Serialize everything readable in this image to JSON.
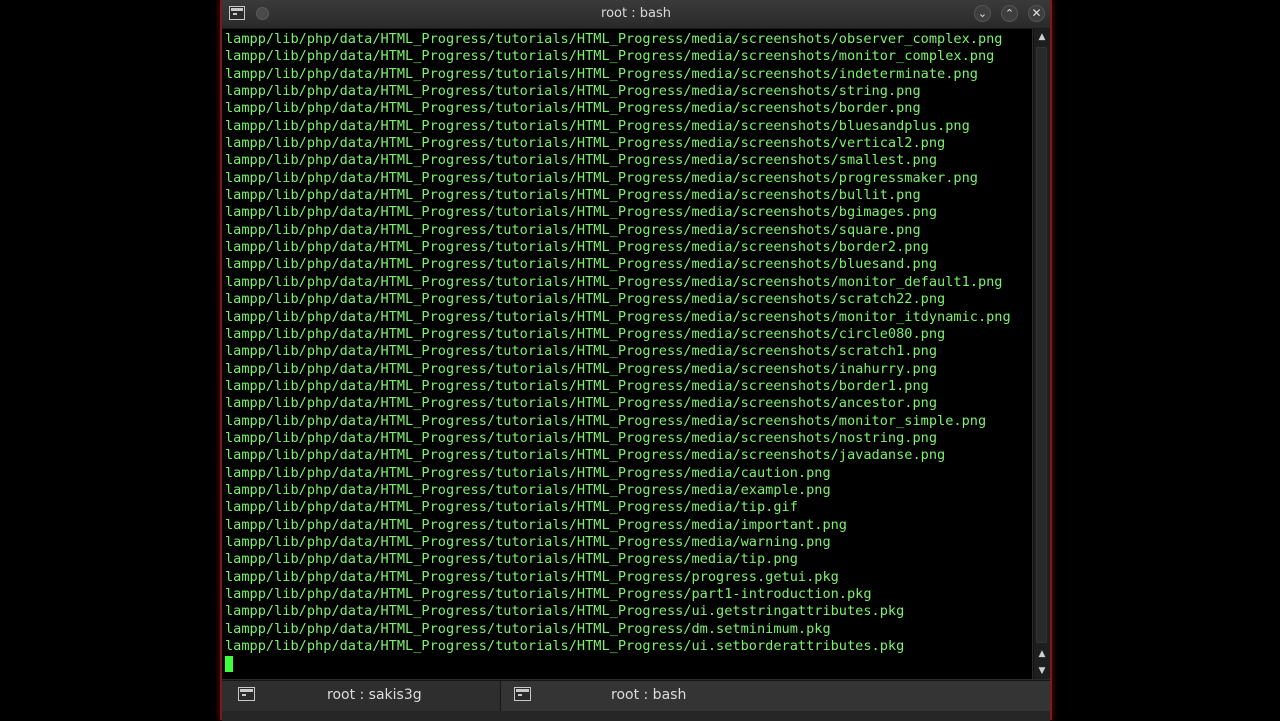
{
  "window": {
    "title": "root : bash"
  },
  "terminal": {
    "lines": [
      "lampp/lib/php/data/HTML_Progress/tutorials/HTML_Progress/media/screenshots/observer_complex.png",
      "lampp/lib/php/data/HTML_Progress/tutorials/HTML_Progress/media/screenshots/monitor_complex.png",
      "lampp/lib/php/data/HTML_Progress/tutorials/HTML_Progress/media/screenshots/indeterminate.png",
      "lampp/lib/php/data/HTML_Progress/tutorials/HTML_Progress/media/screenshots/string.png",
      "lampp/lib/php/data/HTML_Progress/tutorials/HTML_Progress/media/screenshots/border.png",
      "lampp/lib/php/data/HTML_Progress/tutorials/HTML_Progress/media/screenshots/bluesandplus.png",
      "lampp/lib/php/data/HTML_Progress/tutorials/HTML_Progress/media/screenshots/vertical2.png",
      "lampp/lib/php/data/HTML_Progress/tutorials/HTML_Progress/media/screenshots/smallest.png",
      "lampp/lib/php/data/HTML_Progress/tutorials/HTML_Progress/media/screenshots/progressmaker.png",
      "lampp/lib/php/data/HTML_Progress/tutorials/HTML_Progress/media/screenshots/bullit.png",
      "lampp/lib/php/data/HTML_Progress/tutorials/HTML_Progress/media/screenshots/bgimages.png",
      "lampp/lib/php/data/HTML_Progress/tutorials/HTML_Progress/media/screenshots/square.png",
      "lampp/lib/php/data/HTML_Progress/tutorials/HTML_Progress/media/screenshots/border2.png",
      "lampp/lib/php/data/HTML_Progress/tutorials/HTML_Progress/media/screenshots/bluesand.png",
      "lampp/lib/php/data/HTML_Progress/tutorials/HTML_Progress/media/screenshots/monitor_default1.png",
      "lampp/lib/php/data/HTML_Progress/tutorials/HTML_Progress/media/screenshots/scratch22.png",
      "lampp/lib/php/data/HTML_Progress/tutorials/HTML_Progress/media/screenshots/monitor_itdynamic.png",
      "lampp/lib/php/data/HTML_Progress/tutorials/HTML_Progress/media/screenshots/circle080.png",
      "lampp/lib/php/data/HTML_Progress/tutorials/HTML_Progress/media/screenshots/scratch1.png",
      "lampp/lib/php/data/HTML_Progress/tutorials/HTML_Progress/media/screenshots/inahurry.png",
      "lampp/lib/php/data/HTML_Progress/tutorials/HTML_Progress/media/screenshots/border1.png",
      "lampp/lib/php/data/HTML_Progress/tutorials/HTML_Progress/media/screenshots/ancestor.png",
      "lampp/lib/php/data/HTML_Progress/tutorials/HTML_Progress/media/screenshots/monitor_simple.png",
      "lampp/lib/php/data/HTML_Progress/tutorials/HTML_Progress/media/screenshots/nostring.png",
      "lampp/lib/php/data/HTML_Progress/tutorials/HTML_Progress/media/screenshots/javadanse.png",
      "lampp/lib/php/data/HTML_Progress/tutorials/HTML_Progress/media/caution.png",
      "lampp/lib/php/data/HTML_Progress/tutorials/HTML_Progress/media/example.png",
      "lampp/lib/php/data/HTML_Progress/tutorials/HTML_Progress/media/tip.gif",
      "lampp/lib/php/data/HTML_Progress/tutorials/HTML_Progress/media/important.png",
      "lampp/lib/php/data/HTML_Progress/tutorials/HTML_Progress/media/warning.png",
      "lampp/lib/php/data/HTML_Progress/tutorials/HTML_Progress/media/tip.png",
      "lampp/lib/php/data/HTML_Progress/tutorials/HTML_Progress/progress.getui.pkg",
      "lampp/lib/php/data/HTML_Progress/tutorials/HTML_Progress/part1-introduction.pkg",
      "lampp/lib/php/data/HTML_Progress/tutorials/HTML_Progress/ui.getstringattributes.pkg",
      "lampp/lib/php/data/HTML_Progress/tutorials/HTML_Progress/dm.setminimum.pkg",
      "lampp/lib/php/data/HTML_Progress/tutorials/HTML_Progress/ui.setborderattributes.pkg"
    ]
  },
  "tabs": [
    {
      "label": "root : sakis3g"
    },
    {
      "label": "root : bash"
    }
  ],
  "icons": {
    "app": "terminal-icon",
    "minimize": "chevron-down-icon",
    "maximize": "chevron-up-icon",
    "close": "close-icon"
  },
  "colors": {
    "terminal_text": "#7cf26b",
    "terminal_background": "#000000",
    "cursor": "#3cff3c",
    "window_glow": "#c81e1e"
  }
}
